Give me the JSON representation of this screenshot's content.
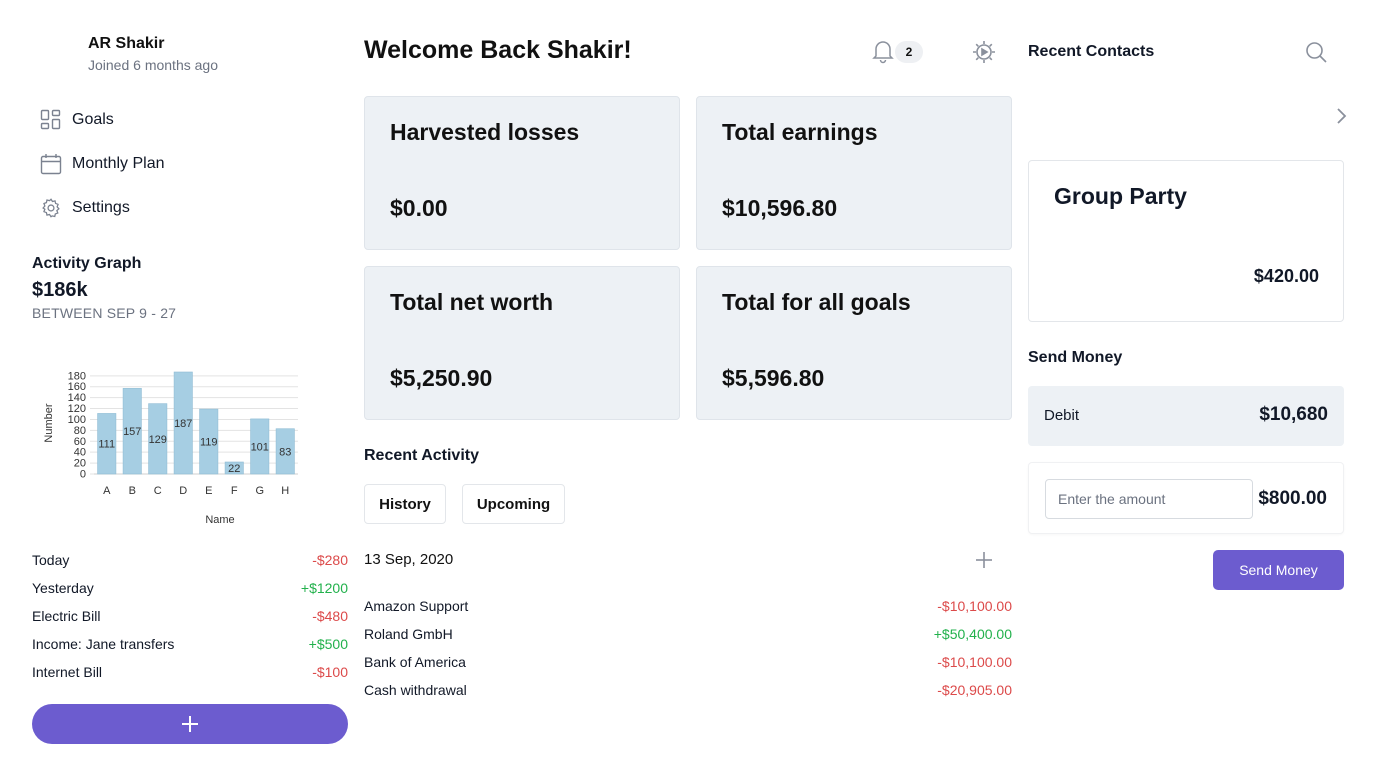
{
  "user": {
    "name": "AR Shakir",
    "joined": "Joined 6 months ago"
  },
  "nav": [
    {
      "label": "Goals",
      "icon": "grid-icon"
    },
    {
      "label": "Monthly Plan",
      "icon": "calendar-icon"
    },
    {
      "label": "Settings",
      "icon": "gear-icon"
    }
  ],
  "activity": {
    "title": "Activity Graph",
    "value": "$186k",
    "range": "BETWEEN SEP 9 - 27"
  },
  "chart_data": {
    "type": "bar",
    "categories": [
      "A",
      "B",
      "C",
      "D",
      "E",
      "F",
      "G",
      "H"
    ],
    "values": [
      111,
      157,
      129,
      187,
      119,
      22,
      101,
      83
    ],
    "xlabel": "Name",
    "ylabel": "Number",
    "yticks": [
      0,
      20,
      40,
      60,
      80,
      100,
      120,
      140,
      160,
      180
    ],
    "ylim": [
      0,
      187
    ],
    "grid": true,
    "bar_color": "#a6cee3"
  },
  "transactions": [
    {
      "label": "Today",
      "amount": "-$280",
      "sign": "neg"
    },
    {
      "label": "Yesterday",
      "amount": "+$1200",
      "sign": "pos"
    },
    {
      "label": "Electric Bill",
      "amount": "-$480",
      "sign": "neg"
    },
    {
      "label": "Income: Jane transfers",
      "amount": "+$500",
      "sign": "pos"
    },
    {
      "label": "Internet Bill",
      "amount": "-$100",
      "sign": "neg"
    }
  ],
  "header": {
    "welcome": "Welcome Back Shakir!",
    "notification_count": "2"
  },
  "cards": [
    {
      "title": "Harvested losses",
      "value": "$0.00"
    },
    {
      "title": "Total earnings",
      "value": "$10,596.80"
    },
    {
      "title": "Total net worth",
      "value": "$5,250.90"
    },
    {
      "title": "Total for all goals",
      "value": "$5,596.80"
    }
  ],
  "recent_activity": {
    "title": "Recent Activity",
    "tabs": [
      "History",
      "Upcoming"
    ],
    "date": "13 Sep, 2020",
    "items": [
      {
        "label": "Amazon Support",
        "amount": "-$10,100.00",
        "sign": "neg"
      },
      {
        "label": "Roland GmbH",
        "amount": "+$50,400.00",
        "sign": "pos"
      },
      {
        "label": "Bank of America",
        "amount": "-$10,100.00",
        "sign": "neg"
      },
      {
        "label": "Cash withdrawal",
        "amount": "-$20,905.00",
        "sign": "neg"
      }
    ]
  },
  "contacts": {
    "title": "Recent Contacts",
    "group": {
      "title": "Group Party",
      "amount": "$420.00"
    }
  },
  "send_money": {
    "title": "Send Money",
    "debit_label": "Debit",
    "debit_value": "$10,680",
    "placeholder": "Enter the amount",
    "amount": "$800.00",
    "button": "Send Money"
  },
  "colors": {
    "accent": "#6c5ccf",
    "negative": "#dc4a4a",
    "positive": "#22b14c",
    "card_bg": "#edf1f5"
  }
}
